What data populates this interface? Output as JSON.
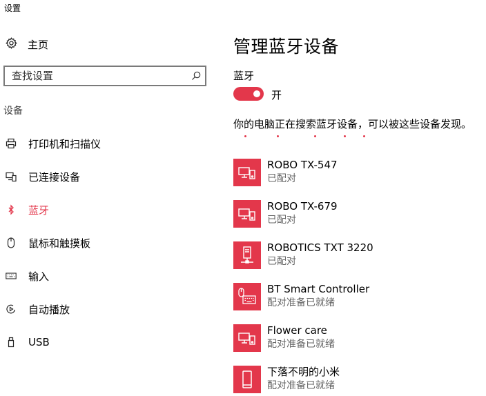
{
  "window": {
    "title": "设置"
  },
  "sidebar": {
    "home_label": "主页",
    "search_placeholder": "查找设置",
    "section_label": "设备",
    "items": [
      {
        "label": "打印机和扫描仪",
        "icon": "printer-icon"
      },
      {
        "label": "已连接设备",
        "icon": "connected-devices-icon"
      },
      {
        "label": "蓝牙",
        "icon": "bluetooth-icon",
        "active": true
      },
      {
        "label": "鼠标和触摸板",
        "icon": "mouse-icon"
      },
      {
        "label": "输入",
        "icon": "keyboard-icon"
      },
      {
        "label": "自动播放",
        "icon": "autoplay-icon"
      },
      {
        "label": "USB",
        "icon": "usb-icon"
      }
    ]
  },
  "main": {
    "title": "管理蓝牙设备",
    "bluetooth_label": "蓝牙",
    "toggle_state": "开",
    "toggle_on": true,
    "description": "你的电脑正在搜索蓝牙设备，可以被这些设备发现。",
    "devices": [
      {
        "name": "ROBO TX-547",
        "status": "已配对",
        "icon": "pc-phone-icon"
      },
      {
        "name": "ROBO TX-679",
        "status": "已配对",
        "icon": "pc-phone-icon"
      },
      {
        "name": "ROBOTICS TXT 3220",
        "status": "已配对",
        "icon": "network-device-icon"
      },
      {
        "name": "BT Smart Controller",
        "status": "配对准备已就绪",
        "icon": "mouse-keyboard-icon"
      },
      {
        "name": "Flower care",
        "status": "配对准备已就绪",
        "icon": "pc-phone-icon"
      },
      {
        "name": "下落不明的小米",
        "status": "配对准备已就绪",
        "icon": "phone-icon"
      }
    ]
  },
  "colors": {
    "accent": "#e3374b",
    "secondary_text": "#666666"
  }
}
